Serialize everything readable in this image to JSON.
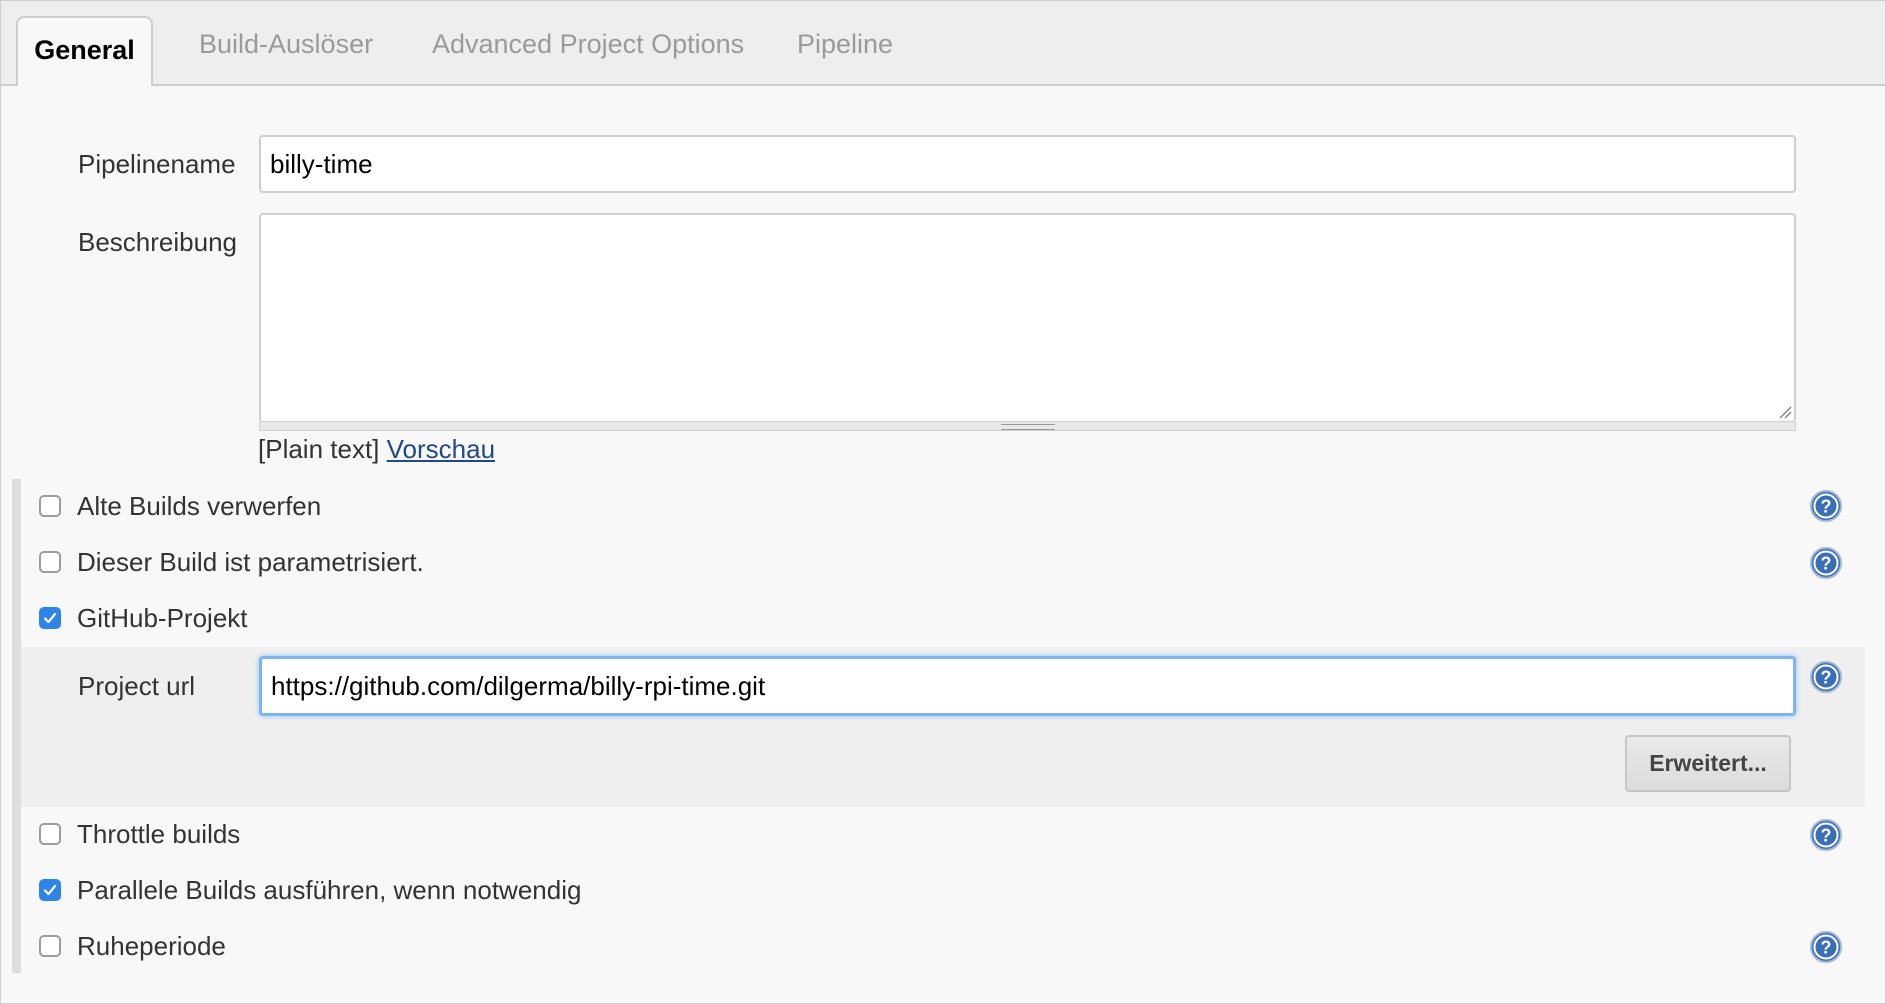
{
  "tabs": [
    {
      "label": "General",
      "active": true
    },
    {
      "label": "Build-Auslöser",
      "active": false
    },
    {
      "label": "Advanced Project Options",
      "active": false
    },
    {
      "label": "Pipeline",
      "active": false
    }
  ],
  "form": {
    "pipeline_name_label": "Pipelinename",
    "pipeline_name_value": "billy-time",
    "description_label": "Beschreibung",
    "description_value": "",
    "format_note": "[Plain text]",
    "preview_link": "Vorschau"
  },
  "options": [
    {
      "label": "Alte Builds verwerfen",
      "checked": false,
      "help": true
    },
    {
      "label": "Dieser Build ist parametrisiert.",
      "checked": false,
      "help": true
    },
    {
      "label": "GitHub-Projekt",
      "checked": true,
      "help": false
    },
    {
      "label": "Throttle builds",
      "checked": false,
      "help": true
    },
    {
      "label": "Parallele Builds ausführen, wenn notwendig",
      "checked": true,
      "help": false
    },
    {
      "label": "Ruheperiode",
      "checked": false,
      "help": true
    }
  ],
  "github": {
    "project_url_label": "Project url",
    "project_url_value": "https://github.com/dilgerma/billy-rpi-time.git",
    "advanced_button": "Erweitert..."
  },
  "colors": {
    "checkbox_checked": "#2f84e7",
    "help_icon": "#3a6fb5",
    "link": "#204a87",
    "focus_ring": "#7db6ee"
  },
  "icons": {
    "help": "question-circle-icon",
    "check": "checkmark-icon"
  }
}
